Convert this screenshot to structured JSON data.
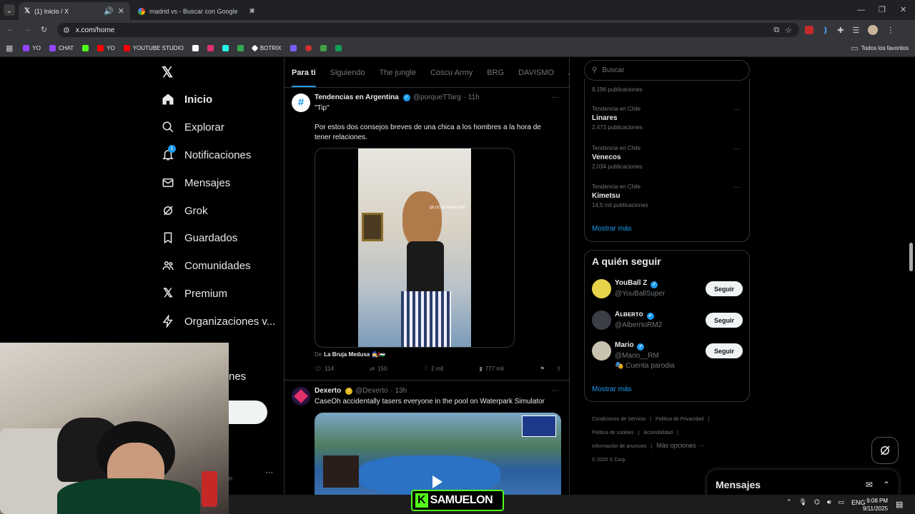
{
  "browser": {
    "tabs": [
      {
        "title": "(1) Inicio / X",
        "active": true
      },
      {
        "title": "madrid vs - Buscar con Google",
        "active": false
      }
    ],
    "url": "x.com/home",
    "bookmarks": [
      {
        "label": "YO",
        "color": "#9146ff"
      },
      {
        "label": "CHAT",
        "color": "#9146ff"
      },
      {
        "label": "",
        "color": "#53fc18"
      },
      {
        "label": "YO",
        "color": "#ff0000"
      },
      {
        "label": "YOUTUBE STUDIO",
        "color": "#ff0000"
      }
    ],
    "bookmarks_extra": [
      {
        "label": "",
        "color": "#ffffff"
      },
      {
        "label": "",
        "color": "#e1306c"
      },
      {
        "label": "",
        "color": "#25f4ee"
      },
      {
        "label": "",
        "color": "#34a853"
      },
      {
        "label": "BOTRIX",
        "color": "#ffffff"
      },
      {
        "label": "",
        "color": "#7b5cff"
      },
      {
        "label": "",
        "color": "#d32f2f"
      },
      {
        "label": "",
        "color": "#43a047"
      },
      {
        "label": "",
        "color": "#0f9d58"
      }
    ],
    "all_bookmarks": "Todos los favoritos"
  },
  "nav": {
    "items": [
      {
        "label": "Inicio",
        "icon": "home-icon"
      },
      {
        "label": "Explorar",
        "icon": "search-icon"
      },
      {
        "label": "Notificaciones",
        "icon": "bell-icon",
        "badge": "1"
      },
      {
        "label": "Mensajes",
        "icon": "mail-icon"
      },
      {
        "label": "Grok",
        "icon": "grok-icon"
      },
      {
        "label": "Guardados",
        "icon": "bookmark-icon"
      },
      {
        "label": "Comunidades",
        "icon": "people-icon"
      },
      {
        "label": "Premium",
        "icon": "x-icon"
      },
      {
        "label": "Organizaciones v...",
        "icon": "bolt-icon"
      }
    ],
    "more_partial": "nes",
    "account_partial": "n",
    "more_dots": "···"
  },
  "feed": {
    "tabs": [
      "Para ti",
      "Siguiendo",
      "The jungle",
      "Coscu Army",
      "BRG",
      "DAVISMO",
      "JC"
    ],
    "posts": [
      {
        "name": "Tendencias en Argentina",
        "handle": "@porqueTTarg",
        "time": "· 11h",
        "subtitle": "\"Tip\"",
        "text": "Por estos dos consejos breves de una chica a los hombres a la hora de tener relaciones.",
        "source_prefix": "De",
        "source_name": "La Bruja Medusa 🧙‍♀️🇵🇸",
        "replies": "114",
        "reposts": "150",
        "likes": "2 mil",
        "views": "777 mil",
        "overlay_text": "@LUCIAJIMENEZDAC"
      },
      {
        "name": "Dexerto",
        "handle": "@Dexerto",
        "time": "· 13h",
        "text": "CaseOh accidentally tasers everyone in the pool on Waterpark Simulator"
      }
    ]
  },
  "search": {
    "placeholder": "Buscar"
  },
  "trends": {
    "first_count": "8.196 publicaciones",
    "items": [
      {
        "meta": "Tendencia en Chile",
        "name": "Linares",
        "count": "2.473 publicaciones"
      },
      {
        "meta": "Tendencia en Chile",
        "name": "Venecos",
        "count": "2.034 publicaciones"
      },
      {
        "meta": "Tendencia en Chile",
        "name": "Kimetsu",
        "count": "14,5 mil publicaciones"
      }
    ],
    "show_more": "Mostrar más"
  },
  "who_to_follow": {
    "title": "A quién seguir",
    "accounts": [
      {
        "name": "YouBall Z",
        "handle": "@YouBallSuper",
        "extra": "",
        "avatar_color": "#e8d24a"
      },
      {
        "name": "Aʟʙᴇʀᴛᴏ",
        "handle": "@AlberrtoRM2",
        "extra": "",
        "avatar_color": "#3a3f47"
      },
      {
        "name": "Mario",
        "handle": "@Mario__RM",
        "extra": "🎭 Cuenta parodia",
        "avatar_color": "#c9c2b0"
      }
    ],
    "follow_label": "Seguir",
    "show_more": "Mostrar más"
  },
  "footer": {
    "links": [
      "Condiciones de Servicio",
      "Política de Privacidad",
      "Política de cookies",
      "Accesibilidad",
      "Información de anuncios",
      "Más opciones ···"
    ],
    "copyright": "© 2025 X Corp."
  },
  "messages": {
    "title": "Mensajes"
  },
  "overlay": {
    "streamer_name": "SAMUELON"
  },
  "taskbar": {
    "lang": "ENG",
    "time": "9:08 PM",
    "date": "9/11/2025"
  }
}
